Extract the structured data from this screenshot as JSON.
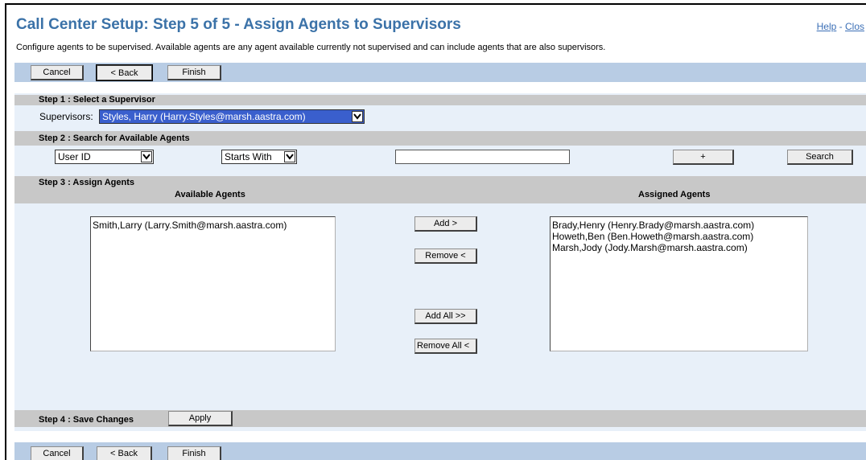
{
  "page": {
    "title": "Call Center Setup: Step 5 of 5 - Assign Agents to Supervisors",
    "help_link": "Help",
    "link_separator": " - ",
    "close_link": "Clos",
    "description": "Configure agents to be supervised. Available agents are any agent available currently not supervised and can include agents that are also supervisors."
  },
  "nav": {
    "cancel": "Cancel",
    "back": "< Back",
    "finish": "Finish"
  },
  "step1": {
    "heading": "Step 1 : Select a Supervisor",
    "label": "Supervisors:",
    "selected": "Styles, Harry (Harry.Styles@marsh.aastra.com)"
  },
  "step2": {
    "heading": "Step 2 : Search for Available Agents",
    "field_select": "User ID",
    "match_select": "Starts With",
    "search_value": "",
    "plus_button": "+",
    "search_button": "Search"
  },
  "step3": {
    "heading": "Step 3 : Assign Agents",
    "available_heading": "Available Agents",
    "assigned_heading": "Assigned Agents",
    "available_agents": [
      "Smith,Larry (Larry.Smith@marsh.aastra.com)"
    ],
    "assigned_agents": [
      "Brady,Henry (Henry.Brady@marsh.aastra.com)",
      "Howeth,Ben (Ben.Howeth@marsh.aastra.com)",
      "Marsh,Jody (Jody.Marsh@marsh.aastra.com)"
    ],
    "add_button": "Add >",
    "remove_button": "Remove <",
    "add_all_button": "Add All >>",
    "remove_all_button": "Remove All <"
  },
  "step4": {
    "heading": "Step 4 : Save Changes",
    "apply_button": "Apply"
  },
  "colors": {
    "title": "#3b72a8",
    "toolbar": "#b8cce4",
    "panel": "#e8f0f9",
    "section_header": "#c8c8c8",
    "selection": "#3a5fcd"
  }
}
